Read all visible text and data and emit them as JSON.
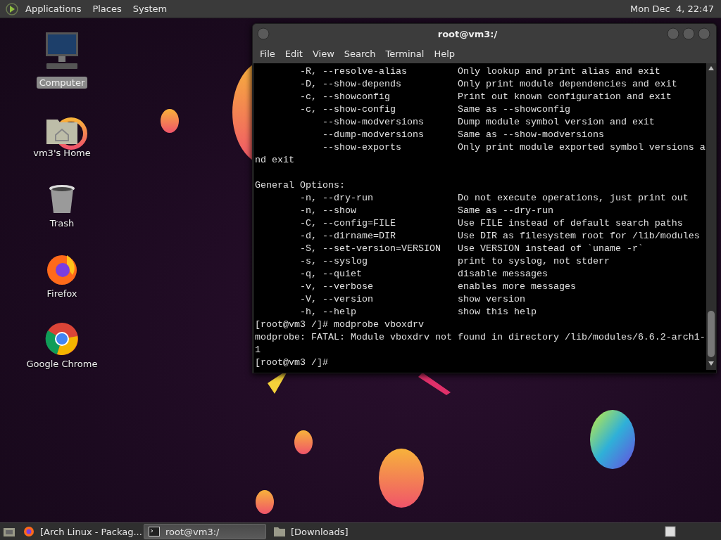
{
  "top_panel": {
    "menus": [
      {
        "label": "Applications"
      },
      {
        "label": "Places"
      },
      {
        "label": "System"
      }
    ],
    "clock": "Mon Dec  4, 22:47"
  },
  "desktop_icons": [
    {
      "kind": "computer",
      "label": "Computer",
      "selected": true
    },
    {
      "kind": "home",
      "label": "vm3's Home",
      "selected": false
    },
    {
      "kind": "trash",
      "label": "Trash",
      "selected": false
    },
    {
      "kind": "firefox",
      "label": "Firefox",
      "selected": false
    },
    {
      "kind": "chrome",
      "label": "Google Chrome",
      "selected": false
    }
  ],
  "terminal": {
    "title": "root@vm3:/",
    "menu": [
      "File",
      "Edit",
      "View",
      "Search",
      "Terminal",
      "Help"
    ],
    "blocks": [
      {
        "lines": [
          "        -R, --resolve-alias         Only lookup and print alias and exit",
          "        -D, --show-depends          Only print module dependencies and exit",
          "        -c, --showconfig            Print out known configuration and exit",
          "        -c, --show-config           Same as --showconfig",
          "            --show-modversions      Dump module symbol version and exit",
          "            --dump-modversions      Same as --show-modversions",
          "            --show-exports          Only print module exported symbol versions a",
          "nd exit"
        ]
      },
      {
        "lines": [
          "General Options:",
          "        -n, --dry-run               Do not execute operations, just print out",
          "        -n, --show                  Same as --dry-run",
          "        -C, --config=FILE           Use FILE instead of default search paths",
          "        -d, --dirname=DIR           Use DIR as filesystem root for /lib/modules",
          "        -S, --set-version=VERSION   Use VERSION instead of `uname -r`",
          "        -s, --syslog                print to syslog, not stderr",
          "        -q, --quiet                 disable messages",
          "        -v, --verbose               enables more messages",
          "        -V, --version               show version",
          "        -h, --help                  show this help",
          "[root@vm3 /]# modprobe vboxdrv",
          "modprobe: FATAL: Module vboxdrv not found in directory /lib/modules/6.6.2-arch1-",
          "1",
          "[root@vm3 /]#"
        ]
      }
    ]
  },
  "taskbar": {
    "tasks": [
      {
        "kind": "browser",
        "label": "[Arch Linux - Packag...",
        "selected": false
      },
      {
        "kind": "terminal",
        "label": "root@vm3:/",
        "selected": true
      },
      {
        "kind": "folder",
        "label": "[Downloads]",
        "selected": false
      }
    ]
  }
}
